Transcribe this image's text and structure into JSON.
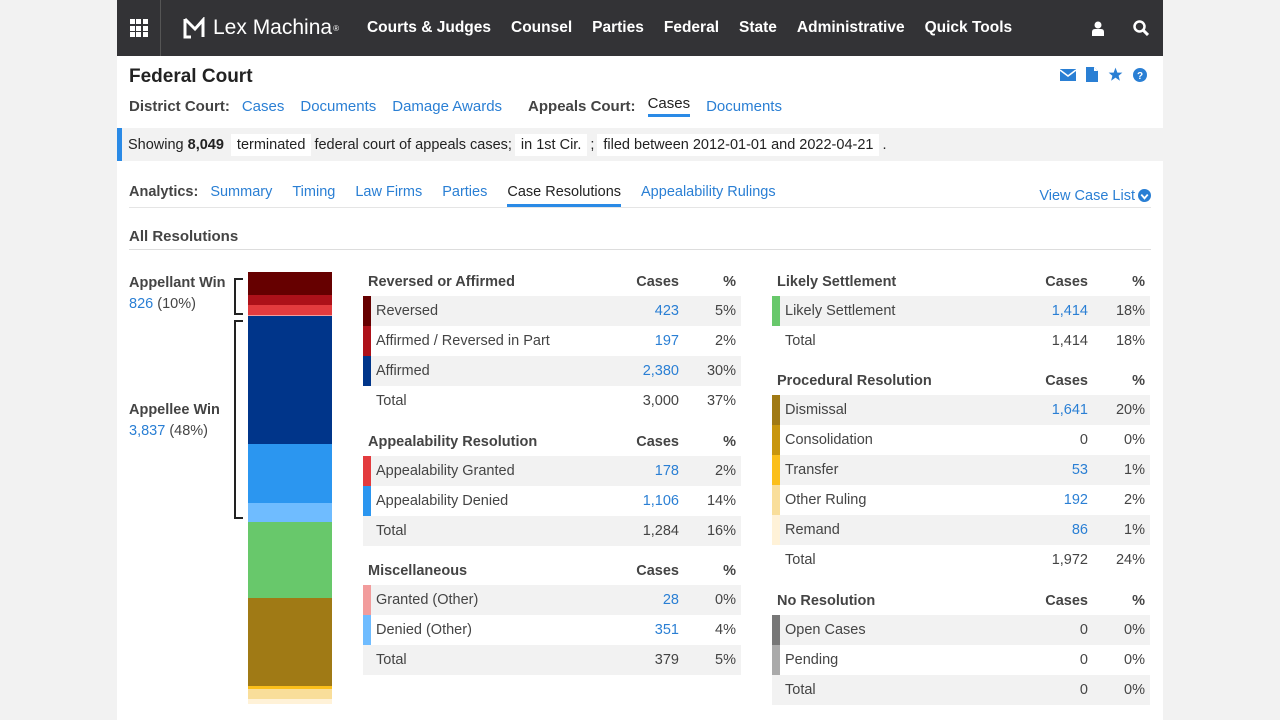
{
  "topbar": {
    "brand": "Lex Machina",
    "nav": [
      "Courts & Judges",
      "Counsel",
      "Parties",
      "Federal",
      "State",
      "Administrative",
      "Quick Tools"
    ]
  },
  "header": {
    "title": "Federal Court",
    "district_label": "District Court:",
    "district_links": [
      "Cases",
      "Documents",
      "Damage Awards"
    ],
    "appeals_label": "Appeals Court:",
    "appeals_links": [
      "Cases",
      "Documents"
    ],
    "appeals_active": "Cases"
  },
  "filter": {
    "prefix": "Showing",
    "count": "8,049",
    "status": "terminated",
    "text1": "federal court of appeals cases;",
    "court": "in 1st Cir.",
    "sep": ";",
    "dates": "filed between 2012-01-01 and 2022-04-21",
    "end": "."
  },
  "analytics": {
    "label": "Analytics:",
    "tabs": [
      "Summary",
      "Timing",
      "Law Firms",
      "Parties",
      "Case Resolutions",
      "Appealability Rulings"
    ],
    "active": "Case Resolutions",
    "view_case_list": "View Case List"
  },
  "section_title": "All Resolutions",
  "groups": {
    "appellant": {
      "label": "Appellant Win",
      "count": "826",
      "pct": "(10%)"
    },
    "appellee": {
      "label": "Appellee Win",
      "count": "3,837",
      "pct": "(48%)"
    }
  },
  "colors": {
    "reversed": "#660000",
    "aff_rev_part": "#ad1119",
    "affirmed": "#00358a",
    "app_granted": "#e33b3e",
    "app_denied": "#2b96f0",
    "granted_other": "#f29c9c",
    "denied_other": "#6fbcff",
    "likely_settlement": "#68c86b",
    "dismissal": "#a07a15",
    "consolidation": "#c8960e",
    "transfer": "#fbbf1a",
    "other_ruling": "#f9de9a",
    "remand": "#fff2d8",
    "open_cases": "#777777",
    "pending": "#aaaaaa",
    "link": "#2a7fd4"
  },
  "chart_data": {
    "type": "bar",
    "title": "All Resolutions (stacked)",
    "segments": [
      {
        "name": "Reversed",
        "value": 423,
        "color": "#660000"
      },
      {
        "name": "Affirmed / Reversed in Part",
        "value": 197,
        "color": "#ad1119"
      },
      {
        "name": "Appealability Granted",
        "value": 178,
        "color": "#e33b3e"
      },
      {
        "name": "Granted (Other)",
        "value": 28,
        "color": "#f29c9c"
      },
      {
        "name": "Affirmed",
        "value": 2380,
        "color": "#00358a"
      },
      {
        "name": "Appealability Denied",
        "value": 1106,
        "color": "#2b96f0"
      },
      {
        "name": "Denied (Other)",
        "value": 351,
        "color": "#6fbcff"
      },
      {
        "name": "Likely Settlement",
        "value": 1414,
        "color": "#68c86b"
      },
      {
        "name": "Dismissal",
        "value": 1641,
        "color": "#a07a15"
      },
      {
        "name": "Consolidation",
        "value": 0,
        "color": "#c8960e"
      },
      {
        "name": "Transfer",
        "value": 53,
        "color": "#fbbf1a"
      },
      {
        "name": "Other Ruling",
        "value": 192,
        "color": "#f9de9a"
      },
      {
        "name": "Remand",
        "value": 86,
        "color": "#fff2d8"
      }
    ],
    "total": 8049
  },
  "tables": {
    "reversed": {
      "title": "Reversed or Affirmed",
      "cases_h": "Cases",
      "pct_h": "%",
      "rows": [
        {
          "name": "Reversed",
          "cases": "423",
          "pct": "5%"
        },
        {
          "name": "Affirmed / Reversed in Part",
          "cases": "197",
          "pct": "2%"
        },
        {
          "name": "Affirmed",
          "cases": "2,380",
          "pct": "30%"
        }
      ],
      "total": {
        "name": "Total",
        "cases": "3,000",
        "pct": "37%"
      }
    },
    "appealability": {
      "title": "Appealability Resolution",
      "cases_h": "Cases",
      "pct_h": "%",
      "rows": [
        {
          "name": "Appealability Granted",
          "cases": "178",
          "pct": "2%"
        },
        {
          "name": "Appealability Denied",
          "cases": "1,106",
          "pct": "14%"
        }
      ],
      "total": {
        "name": "Total",
        "cases": "1,284",
        "pct": "16%"
      }
    },
    "misc": {
      "title": "Miscellaneous",
      "cases_h": "Cases",
      "pct_h": "%",
      "rows": [
        {
          "name": "Granted (Other)",
          "cases": "28",
          "pct": "0%"
        },
        {
          "name": "Denied (Other)",
          "cases": "351",
          "pct": "4%"
        }
      ],
      "total": {
        "name": "Total",
        "cases": "379",
        "pct": "5%"
      }
    },
    "settlement": {
      "title": "Likely Settlement",
      "cases_h": "Cases",
      "pct_h": "%",
      "rows": [
        {
          "name": "Likely Settlement",
          "cases": "1,414",
          "pct": "18%"
        }
      ],
      "total": {
        "name": "Total",
        "cases": "1,414",
        "pct": "18%"
      }
    },
    "procedural": {
      "title": "Procedural Resolution",
      "cases_h": "Cases",
      "pct_h": "%",
      "rows": [
        {
          "name": "Dismissal",
          "cases": "1,641",
          "pct": "20%"
        },
        {
          "name": "Consolidation",
          "cases": "0",
          "pct": "0%"
        },
        {
          "name": "Transfer",
          "cases": "53",
          "pct": "1%"
        },
        {
          "name": "Other Ruling",
          "cases": "192",
          "pct": "2%"
        },
        {
          "name": "Remand",
          "cases": "86",
          "pct": "1%"
        }
      ],
      "total": {
        "name": "Total",
        "cases": "1,972",
        "pct": "24%"
      }
    },
    "none": {
      "title": "No Resolution",
      "cases_h": "Cases",
      "pct_h": "%",
      "rows": [
        {
          "name": "Open Cases",
          "cases": "0",
          "pct": "0%"
        },
        {
          "name": "Pending",
          "cases": "0",
          "pct": "0%"
        }
      ],
      "total": {
        "name": "Total",
        "cases": "0",
        "pct": "0%"
      }
    }
  }
}
